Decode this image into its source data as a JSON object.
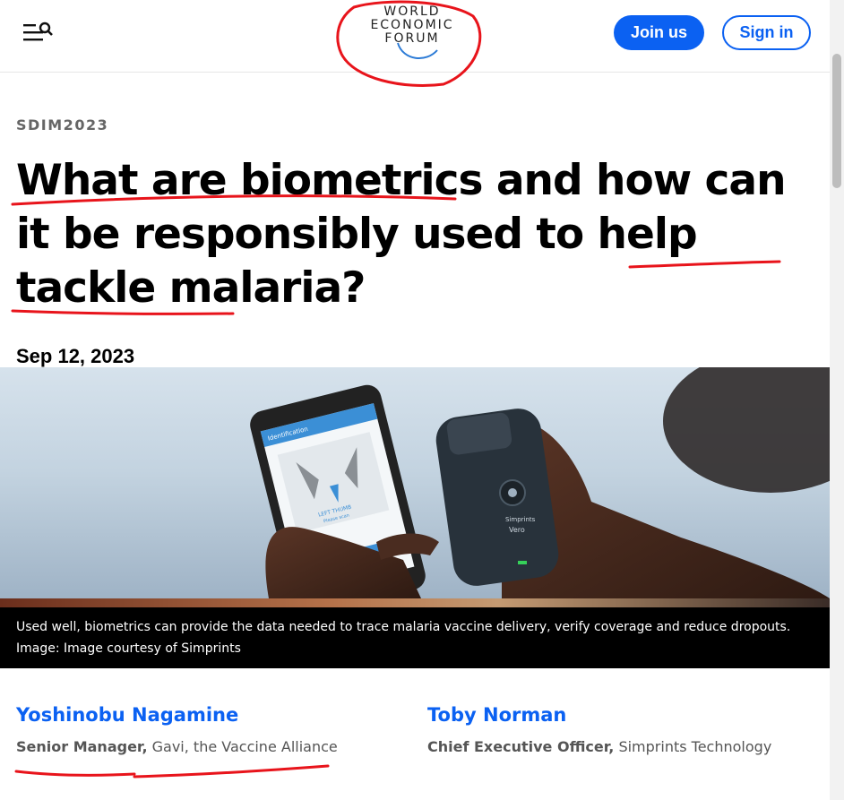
{
  "header": {
    "logo_lines": [
      "WORLD",
      "ECONOMIC",
      "FORUM"
    ],
    "join_label": "Join us",
    "signin_label": "Sign in",
    "menu_icon": "menu-search-icon",
    "accent_color": "#0b61f2"
  },
  "article": {
    "tag": "SDIM2023",
    "title": "What are biometrics and how can it be responsibly used to help tackle malaria?",
    "date": "Sep 12, 2023"
  },
  "hero_image": {
    "phone_screen_heading": "Identification",
    "phone_screen_label": "LEFT THUMB",
    "phone_screen_subtext": "Please scan",
    "scanner_brand": "Simprints",
    "scanner_model": "Vero"
  },
  "caption": {
    "text": "Used well, biometrics can provide the data needed to trace malaria vaccine delivery, verify coverage and reduce dropouts.",
    "credit": "Image: Image courtesy of Simprints"
  },
  "authors": [
    {
      "name": "Yoshinobu Nagamine",
      "title": "Senior Manager,",
      "org": "Gavi, the Vaccine Alliance"
    },
    {
      "name": "Toby Norman",
      "title": "Chief Executive Officer,",
      "org": "Simprints Technology"
    }
  ],
  "annotation_color": "#e8141b"
}
